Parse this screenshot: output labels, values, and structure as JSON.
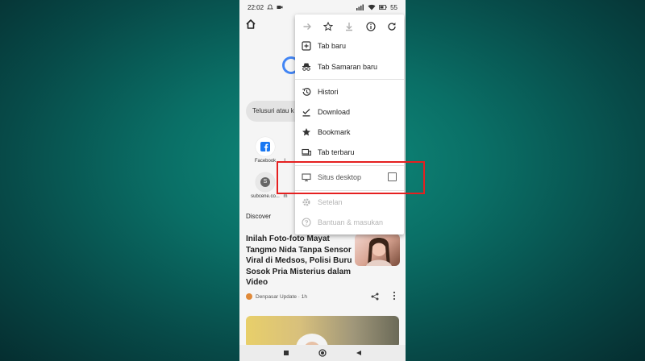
{
  "status_bar": {
    "time": "22:02",
    "battery": "55"
  },
  "search": {
    "placeholder": "Telusuri atau k"
  },
  "shortcuts": [
    {
      "label": "Facebook"
    },
    {
      "label": "L"
    },
    {
      "label": "subcene.co..."
    },
    {
      "label": "m"
    }
  ],
  "discover": {
    "label": "Discover"
  },
  "article": {
    "title": "Inilah Foto-foto Mayat Tangmo Nida Tanpa Sensor Viral di Medsos, Polisi Buru Sosok Pria Misterius dalam Video",
    "source": "Denpasar Update · 1h"
  },
  "menu": {
    "items": [
      {
        "label": "Tab baru",
        "icon": "plus-box-icon",
        "enabled": true
      },
      {
        "label": "Tab Samaran baru",
        "icon": "incognito-icon",
        "enabled": true
      },
      {
        "label": "Histori",
        "icon": "history-icon",
        "enabled": true
      },
      {
        "label": "Download",
        "icon": "download-icon",
        "enabled": true
      },
      {
        "label": "Bookmark",
        "icon": "star-icon",
        "enabled": true
      },
      {
        "label": "Tab terbaru",
        "icon": "devices-icon",
        "enabled": true
      },
      {
        "label": "Situs desktop",
        "icon": "desktop-icon",
        "enabled": true,
        "checked": false
      },
      {
        "label": "Setelan",
        "icon": "gear-icon",
        "enabled": false
      },
      {
        "label": "Bantuan & masukan",
        "icon": "help-icon",
        "enabled": false
      }
    ]
  },
  "colors": {
    "highlight": "#e52020",
    "accent": "#4285f4"
  }
}
